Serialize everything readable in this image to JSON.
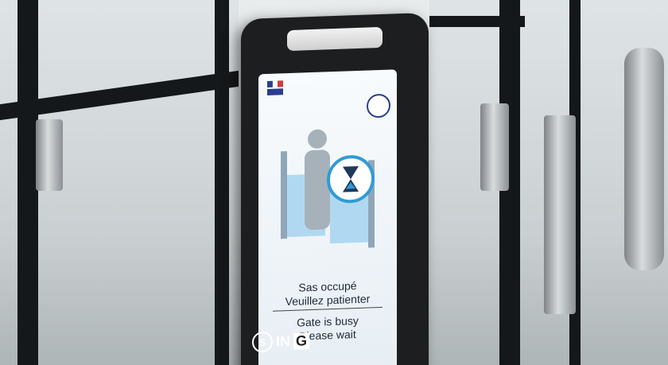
{
  "screen": {
    "message_fr_line1": "Sas occupé",
    "message_fr_line2": "Veuillez patienter",
    "message_en_line1": "Gate is busy",
    "message_en_line2": "Please wait"
  },
  "branding": {
    "logo_left": "S",
    "logo_mid": "IN",
    "logo_right": "G"
  },
  "colors": {
    "device_body": "#1c1e20",
    "screen_bg": "#f4f8fb",
    "accent_blue": "#2f9bd6",
    "flag_blue": "#2b3e8c",
    "flag_red": "#d33a3a"
  },
  "icons": [
    "hourglass-icon",
    "french-flag-icon",
    "seal-icon",
    "person-icon",
    "turnstile-icon"
  ]
}
